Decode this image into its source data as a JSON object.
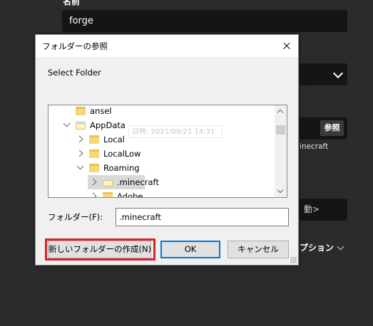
{
  "background": {
    "top_label": "名前",
    "name_value": "forge",
    "browse_label": "参照",
    "path_suffix": "inecraft",
    "move_label": "動>",
    "options_label": "プション"
  },
  "dialog": {
    "title": "フォルダーの参照",
    "description": "Select Folder",
    "tree": [
      {
        "label": "ansel",
        "level": 1,
        "expander": "none",
        "icon": "folder"
      },
      {
        "label": "AppData",
        "level": 1,
        "expander": "expanded",
        "icon": "page-folder"
      },
      {
        "label": "Local",
        "level": 2,
        "expander": "collapsed",
        "icon": "folder"
      },
      {
        "label": "LocalLow",
        "level": 2,
        "expander": "collapsed",
        "icon": "folder"
      },
      {
        "label": "Roaming",
        "level": 2,
        "expander": "expanded",
        "icon": "folder"
      },
      {
        "label": ".minecraft",
        "level": 3,
        "expander": "collapsed",
        "icon": "page-folder",
        "selected": true
      },
      {
        "label": "Adobe",
        "level": 3,
        "expander": "collapsed",
        "icon": "folder"
      }
    ],
    "tooltip_ghost": "日時: 2021/09/21 14:31",
    "folder_label": "フォルダー(F):",
    "folder_value": ".minecraft",
    "buttons": {
      "new_folder": "新しいフォルダーの作成(N)",
      "ok": "OK",
      "cancel": "キャンセル"
    }
  },
  "colors": {
    "background": "#2b2b2b",
    "highlight_box": "#d9232d",
    "default_button_border": "#0078d7"
  }
}
